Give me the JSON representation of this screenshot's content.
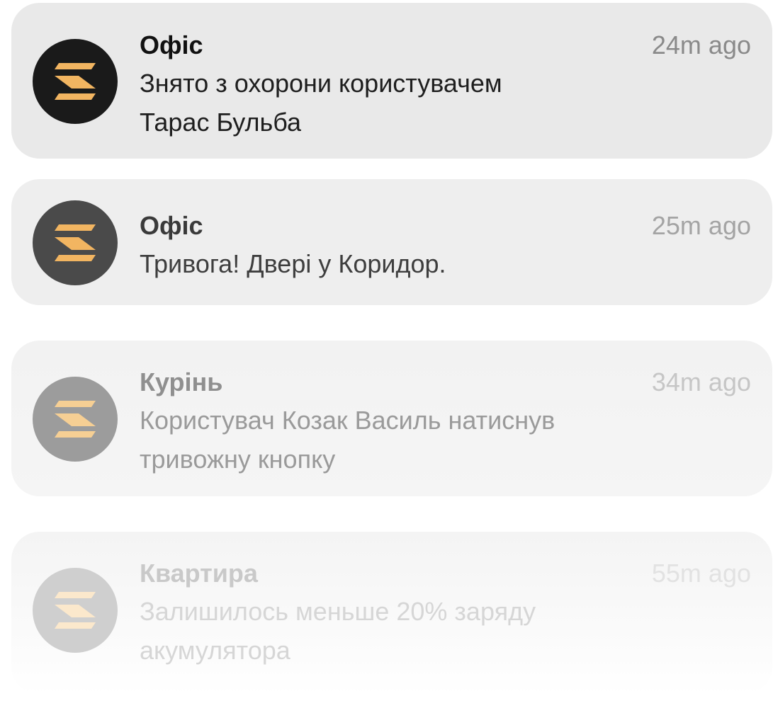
{
  "colors": {
    "logo_accent": "#f2b561",
    "avatar_dark": "#1a1a1a"
  },
  "notifications": [
    {
      "title": "Офіс",
      "time": "24m ago",
      "message_lines": [
        "Знято з охорони користувачем",
        "Тарас Бульба"
      ],
      "icon": "app-logo-icon"
    },
    {
      "title": "Офіс",
      "time": "25m ago",
      "message_lines": [
        "Тривога! Двері у Коридор."
      ],
      "icon": "app-logo-icon"
    },
    {
      "title": "Курінь",
      "time": "34m ago",
      "message_lines": [
        "Користувач Козак Василь натиснув",
        "тривожну кнопку"
      ],
      "icon": "app-logo-icon"
    },
    {
      "title": "Квартира",
      "time": "55m ago",
      "message_lines": [
        "Залишилось меньше 20% заряду",
        "акумулятора"
      ],
      "icon": "app-logo-icon"
    }
  ]
}
